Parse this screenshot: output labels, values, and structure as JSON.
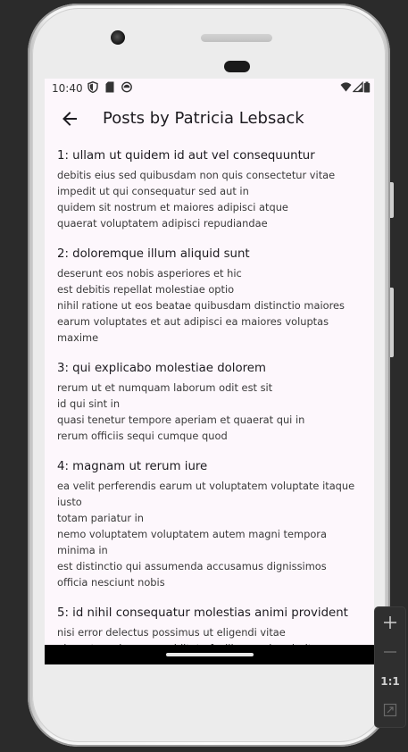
{
  "status_bar": {
    "time": "10:40",
    "left_icons": [
      "shield-icon",
      "sd-card-icon",
      "android-icon"
    ],
    "right_icons": [
      "wifi-icon",
      "signal-icon",
      "battery-icon"
    ]
  },
  "app_bar": {
    "back_icon": "arrow-left-icon",
    "title": "Posts by Patricia Lebsack"
  },
  "posts": [
    {
      "title": "1: ullam ut quidem id aut vel consequuntur",
      "body": "debitis eius sed quibusdam non quis consectetur vitae\nimpedit ut qui consequatur sed aut in\nquidem sit nostrum et maiores adipisci atque\nquaerat voluptatem adipisci repudiandae"
    },
    {
      "title": "2: doloremque illum aliquid sunt",
      "body": "deserunt eos nobis asperiores et hic\nest debitis repellat molestiae optio\nnihil ratione ut eos beatae quibusdam distinctio maiores\nearum voluptates et aut adipisci ea maiores voluptas\nmaxime"
    },
    {
      "title": "3: qui explicabo molestiae dolorem",
      "body": "rerum ut et numquam laborum odit est sit\nid qui sint in\nquasi tenetur tempore aperiam et quaerat qui in\nrerum officiis sequi cumque quod"
    },
    {
      "title": "4: magnam ut rerum iure",
      "body": "ea velit perferendis earum ut voluptatem voluptate itaque\niusto\ntotam pariatur in\nnemo voluptatem voluptatem autem magni tempora\nminima in\nest distinctio qui assumenda accusamus dignissimos\nofficia nesciunt nobis"
    },
    {
      "title": "5: id nihil consequatur molestias animi provident",
      "body": "nisi error delectus possimus ut eligendi vitae\nplaceat eos harum cupiditate facilis reprehenderit"
    }
  ],
  "emulator_toolbar": {
    "zoom_in_icon": "plus-icon",
    "zoom_out_icon": "minus-icon",
    "actual_size_label": "1:1",
    "fit_icon": "fit-screen-icon"
  },
  "colors": {
    "screen_background": "#fdf7fc",
    "title_text": "#1d1b20"
  }
}
